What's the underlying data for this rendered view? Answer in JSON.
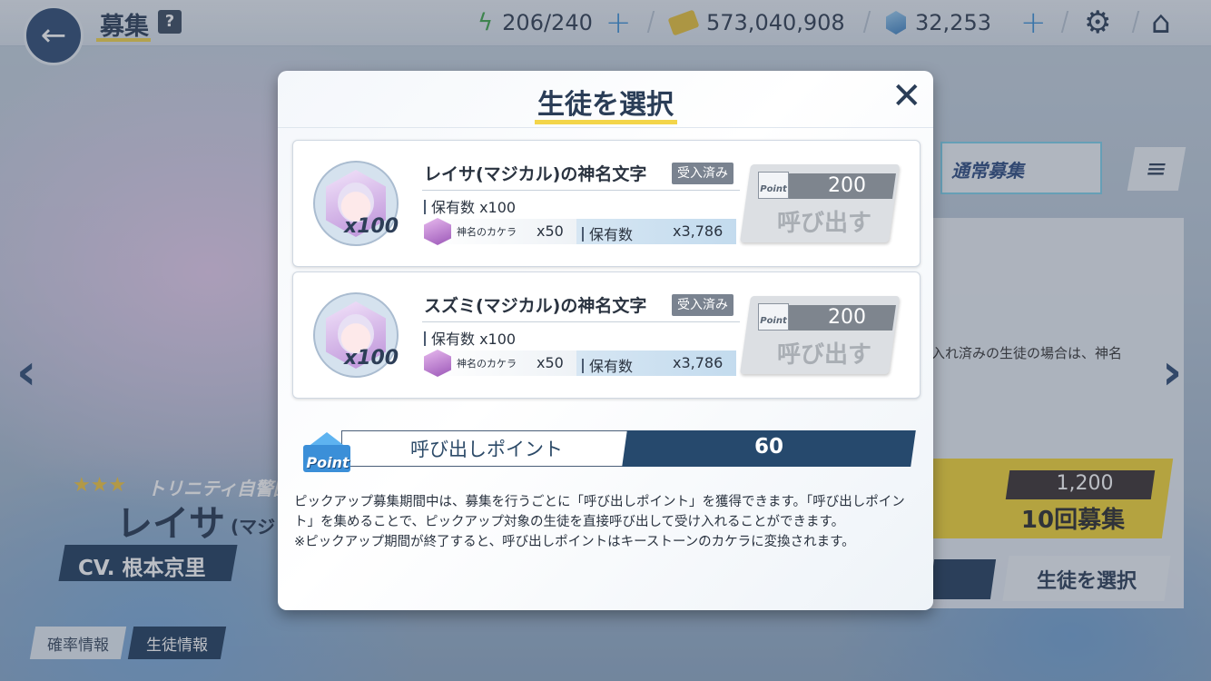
{
  "topbar": {
    "title": "募集",
    "help": "?",
    "ap": "206/240",
    "credits": "573,040,908",
    "pyroxene": "32,253",
    "plus": "+"
  },
  "background": {
    "tab_normal": "通常募集",
    "desc_fragment": "入れ済みの生徒の場合は、神名",
    "pull10_cost": "1,200",
    "pull10_label": "10回募集",
    "pull10_badge": "10",
    "select_student": "生徒を選択",
    "stars": "★★★",
    "school": "トリニティ自警団",
    "char_name": "レイサ",
    "char_name_sub": "(マジ",
    "cv": "CV. 根本京里",
    "tab_prob": "確率情報",
    "tab_info": "生徒情報"
  },
  "modal": {
    "title": "生徒を選択",
    "close_icon": "close-icon",
    "items": [
      {
        "name": "レイサ(マジカル)の神名文字",
        "badge": "受入済み",
        "owned": "保有数 x100",
        "qty_overlay": "x100",
        "material_name": "神名のカケラ",
        "material_qty": "x50",
        "held_label": "保有数",
        "held_value": "x3,786",
        "cost": "200",
        "call_label": "呼び出す"
      },
      {
        "name": "スズミ(マジカル)の神名文字",
        "badge": "受入済み",
        "owned": "保有数 x100",
        "qty_overlay": "x100",
        "material_name": "神名のカケラ",
        "material_qty": "x50",
        "held_label": "保有数",
        "held_value": "x3,786",
        "cost": "200",
        "call_label": "呼び出す"
      }
    ],
    "point_icon_text": "Point",
    "point_label": "呼び出しポイント",
    "point_value": "60",
    "description_1": "ピックアップ募集期間中は、募集を行うごとに「呼び出しポイント」を獲得できます。「呼び出しポイント」を集めることで、ピックアップ対象の生徒を直接呼び出して受け入れることができます。",
    "description_2": "※ピックアップ期間が終了すると、呼び出しポイントはキーストーンのカケラに変換されます。"
  },
  "colors": {
    "accent_yellow": "#f3d54a",
    "navy": "#26496d",
    "disabled_button": "#dcdfe3"
  }
}
